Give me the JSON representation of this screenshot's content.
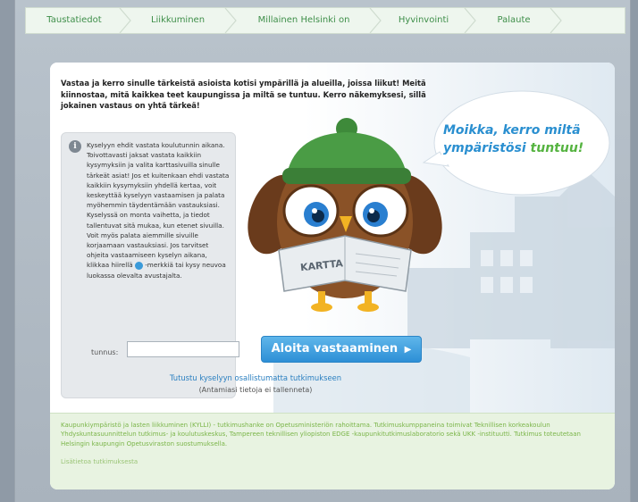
{
  "nav": {
    "items": [
      {
        "label": "Taustatiedot"
      },
      {
        "label": "Liikkuminen"
      },
      {
        "label": "Millainen Helsinki on"
      },
      {
        "label": "Hyvinvointi"
      },
      {
        "label": "Palaute"
      }
    ]
  },
  "intro": {
    "text": "Vastaa ja kerro sinulle tärkeistä asioista kotisi ympärillä ja alueilla, joissa liikut! Meitä kiinnostaa, mitä kaikkea teet kaupungissa ja miltä se tuntuu. Kerro näkemyksesi, sillä jokainen vastaus on yhtä tärkeä!"
  },
  "info": {
    "icon": "info-icon",
    "text_before": "Kyselyyn ehdit vastata koulutunnin aikana. Toivottavasti jaksat vastata kaikkiin kysymyksiin ja valita karttasivuilla sinulle tärkeät asiat! Jos et kuitenkaan ehdi vastata kaikkiin kysymyksiin yhdellä kertaa, voit keskeyttää kyselyyn vastaamisen ja palata myöhemmin täydentämään vastauksiasi. Kyselyssä on monta vaihetta, ja tiedot tallentuvat sitä mukaa, kun etenet sivuilla. Voit myös palata aiemmille sivuille korjaamaan vastauksiasi. Jos tarvitset ohjeita vastaamiseen kyselyn aikana, klikkaa hiirellä",
    "text_after": "-merkkiä tai kysy neuvoa luokassa olevalta avustajalta."
  },
  "bubble": {
    "line1": "Moikka, kerro miltä",
    "line2_blue": "ympäristösi",
    "line2_green": "tuntuu!"
  },
  "illustration": {
    "map_label": "KARTTA"
  },
  "login": {
    "label": "tunnus:",
    "value": "",
    "button_label": "Aloita vastaaminen",
    "button_arrow": "▶"
  },
  "links": {
    "research_link": "Tutustu kyselyyn osallistumatta tutkimukseen",
    "research_note": "(Antamiasi tietoja ei tallenneta)"
  },
  "footer": {
    "text": "Kaupunkiympäristö ja lasten liikkuminen (KYLLI) - tutkimushanke on Opetusministeriön rahoittama. Tutkimuskumppaneina toimivat Teknillisen korkeakoulun Yhdyskuntasuunnittelun tutkimus- ja koulutuskeskus, Tampereen teknillisen yliopiston EDGE -kaupunkitutkimuslaboratorio sekä UKK -instituutti. Tutkimus toteutetaan Helsingin kaupungin Opetusviraston suostumuksella.",
    "link": "Lisätietoa tutkimuksesta"
  },
  "colors": {
    "accent_blue": "#2a8fd0",
    "accent_green": "#55b340",
    "nav_text": "#3f8f4a"
  }
}
